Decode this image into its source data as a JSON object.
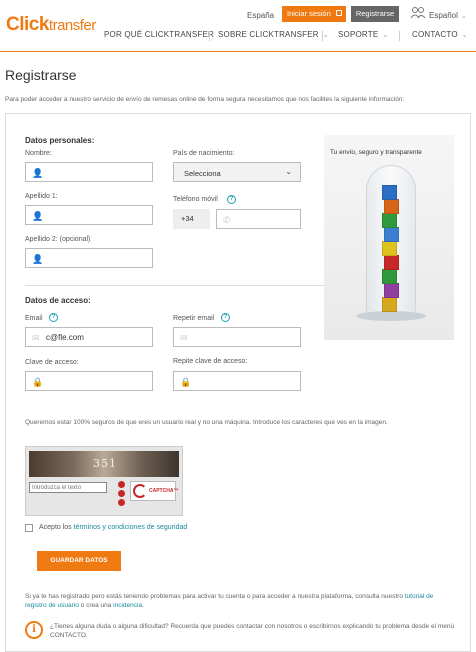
{
  "header": {
    "logo_click": "Click",
    "logo_transfer": "transfer",
    "country": "España",
    "login_label": "Iniciar sesión",
    "register_label": "Registrarse",
    "language": "Español",
    "nav": [
      "POR QUÉ CLICKTRANSFER",
      "SOBRE CLICKTRANSFER",
      "SOPORTE",
      "CONTACTO"
    ],
    "accent_color": "#f07a12"
  },
  "page": {
    "title": "Registrarse",
    "intro": "Para poder acceder a nuestro servicio de envío de remesas online de forma segura necesitamos que nos facilites la siguiente información:"
  },
  "personal": {
    "section_title": "Datos personales:",
    "name_label": "Nombre:",
    "surname1_label": "Apellido 1:",
    "surname2_label": "Apellido 2: (opcional)",
    "country_label": "País de nacimiento:",
    "country_value": "Selecciona",
    "phone_label": "Teléfono móvil",
    "phone_prefix": "+34"
  },
  "access": {
    "section_title": "Datos de acceso:",
    "email_label": "Email",
    "email_value": "c@fle.com",
    "repeat_email_label": "Repetir email",
    "password_label": "Clave de acceso:",
    "repeat_password_label": "Repite clave de acceso:"
  },
  "promo": {
    "text": "Tu envío, seguro y transparente",
    "cube_colors": [
      "#d6a81e",
      "#8e3fa0",
      "#2f9a3b",
      "#c62828",
      "#e0c21e",
      "#3a7fd0",
      "#2f9a3b",
      "#d8641a",
      "#2a6fc4"
    ]
  },
  "captcha": {
    "instructions": "Queremos estar 100% seguros de que eres un usuario real y no una máquina. Introduce los caracteres que ves en la imagen.",
    "word": "351",
    "input_placeholder": "Introduzca el texto",
    "brand": "CAPTCHA™"
  },
  "terms": {
    "prefix": "Acepto los ",
    "link": "términos y condiciones de seguridad"
  },
  "save_label": "GUARDAR DATOS",
  "help": {
    "text_before": "Si ya te has registrado pero estás teniendo problemas para activar tu cuenta o para acceder a nuestra plataforma, consulta nuestro ",
    "tutorial_link": "tutorial de registro de usuario",
    "text_mid": " o crea una ",
    "incident_link": "incidencia",
    "text_end": ".",
    "info": "¿Tienes alguna duda o alguna dificultad? Recuerda que puedes contactar con nosotros o escribirnos explicando tu problema desde el menú CONTACTO."
  }
}
